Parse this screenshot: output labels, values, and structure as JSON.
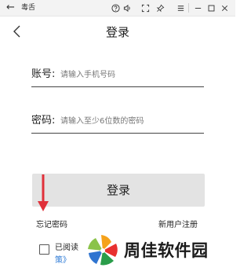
{
  "window": {
    "app_title": "毒舌",
    "icons": [
      "back-arrow-icon",
      "help-icon",
      "volume-icon",
      "fullscreen-icon",
      "pin-icon",
      "menu-icon",
      "minimize-icon",
      "maximize-icon",
      "close-icon"
    ]
  },
  "header": {
    "title": "登录",
    "back_icon": "chevron-left-icon"
  },
  "form": {
    "account": {
      "label": "账号:",
      "placeholder": "请输入手机号码",
      "value": ""
    },
    "password": {
      "label": "密码:",
      "placeholder": "请输入至少6位数的密码",
      "value": ""
    },
    "login_button": "登录"
  },
  "links": {
    "forgot_password": "忘记密码",
    "register": "新用户注册"
  },
  "agreement": {
    "checked": false,
    "read_label": "已阅读",
    "policy_link": "策》"
  },
  "annotation": {
    "arrow_color": "#e0303a"
  },
  "watermark": {
    "text": "周佳软件园",
    "logo": "colorful-pinwheel-logo"
  },
  "colors": {
    "button_bg": "#e3e3e3",
    "link_blue": "#2e7bd6",
    "titlebar_bg": "#f3f3f3"
  }
}
